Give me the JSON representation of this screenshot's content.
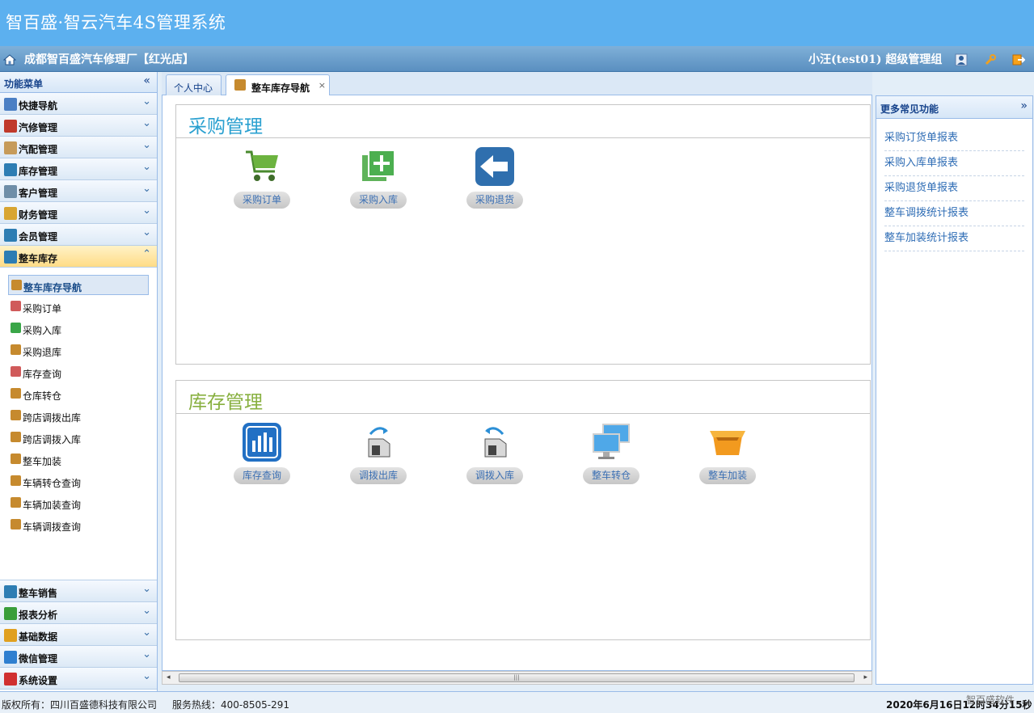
{
  "app": {
    "title": "智百盛·智云汽车4S管理系统"
  },
  "subbar": {
    "company": "成都智百盛汽车修理厂【红光店】",
    "user": "小汪(test01) 超级管理组"
  },
  "sidebar": {
    "header": "功能菜单",
    "collapse_glyph": "«",
    "expand_glyph": "»",
    "up_glyph": "⌃",
    "top_items": [
      {
        "label": "快捷导航",
        "color": "#4b7fc4"
      },
      {
        "label": "汽修管理",
        "color": "#c0392b"
      },
      {
        "label": "汽配管理",
        "color": "#c69b5a"
      },
      {
        "label": "库存管理",
        "color": "#2d7db3"
      },
      {
        "label": "客户管理",
        "color": "#6f8ea8"
      },
      {
        "label": "财务管理",
        "color": "#d8a532"
      },
      {
        "label": "会员管理",
        "color": "#2d7db3"
      }
    ],
    "active_item": {
      "label": "整车库存",
      "color": "#2d7db3"
    },
    "sub_items": [
      {
        "label": "整车库存导航",
        "color": "#c68a2e"
      },
      {
        "label": "采购订单",
        "color": "#d05a5a"
      },
      {
        "label": "采购入库",
        "color": "#3aa648"
      },
      {
        "label": "采购退库",
        "color": "#c68a2e"
      },
      {
        "label": "库存查询",
        "color": "#d05a5a"
      },
      {
        "label": "仓库转仓",
        "color": "#c68a2e"
      },
      {
        "label": "跨店调拨出库",
        "color": "#c68a2e"
      },
      {
        "label": "跨店调拨入库",
        "color": "#c68a2e"
      },
      {
        "label": "整车加装",
        "color": "#c68a2e"
      },
      {
        "label": "车辆转仓查询",
        "color": "#c68a2e"
      },
      {
        "label": "车辆加装查询",
        "color": "#c68a2e"
      },
      {
        "label": "车辆调拨查询",
        "color": "#c68a2e"
      }
    ],
    "bottom_items": [
      {
        "label": "整车销售",
        "color": "#2d7db3"
      },
      {
        "label": "报表分析",
        "color": "#3a9e3a"
      },
      {
        "label": "基础数据",
        "color": "#e0a020"
      },
      {
        "label": "微信管理",
        "color": "#2f7fd0"
      },
      {
        "label": "系统设置",
        "color": "#d03030"
      }
    ]
  },
  "tabs": [
    {
      "label": "个人中心"
    },
    {
      "label": "整车库存导航",
      "close": "×"
    }
  ],
  "sections": {
    "purchase": {
      "title": "采购管理",
      "color": "#2aa0d0",
      "tiles": [
        {
          "label": "采购订单"
        },
        {
          "label": "采购入库"
        },
        {
          "label": "采购退货"
        }
      ]
    },
    "inventory": {
      "title": "库存管理",
      "color": "#88b040",
      "tiles": [
        {
          "label": "库存查询"
        },
        {
          "label": "调拨出库"
        },
        {
          "label": "调拨入库"
        },
        {
          "label": "整车转仓"
        },
        {
          "label": "整车加装"
        }
      ]
    }
  },
  "scroll": {
    "left": "◂",
    "right": "▸",
    "grip": "|||"
  },
  "right_panel": {
    "title": "更多常见功能",
    "links": [
      "采购订货单报表",
      "采购入库单报表",
      "采购退货单报表",
      "整车调拨统计报表",
      "整车加装统计报表"
    ]
  },
  "status": {
    "copyright": "版权所有：四川百盛德科技有限公司",
    "hotline": "服务热线：400-8505-291",
    "datetime": "2020年6月16日12时34分15秒",
    "watermark": "智百盛软件"
  }
}
